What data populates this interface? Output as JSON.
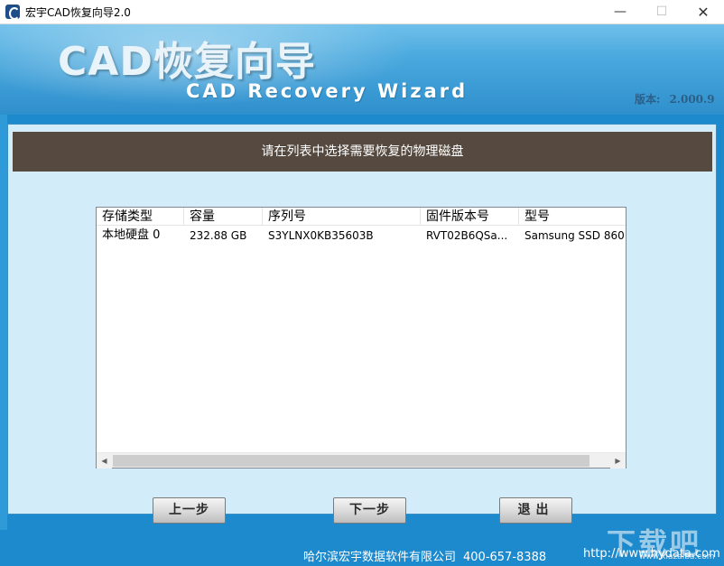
{
  "window": {
    "title": "宏宇CAD恢复向导2.0",
    "minimize_glyph": "—",
    "maximize_glyph": "☐",
    "close_glyph": "✕"
  },
  "banner": {
    "title_cn": "CAD恢复向导",
    "title_en": "CAD Recovery Wizard",
    "version_label": "版本:",
    "version_value": "2.000.9"
  },
  "instruction": "请在列表中选择需要恢复的物理磁盘",
  "disk_list": {
    "columns": [
      "存储类型",
      "容量",
      "序列号",
      "固件版本号",
      "型号"
    ],
    "rows": [
      {
        "type": "本地硬盘 0",
        "capacity": "232.88 GB",
        "serial": "S3YLNX0KB35603B",
        "firmware": "RVT02B6QSa...",
        "model": "Samsung SSD 860"
      }
    ],
    "scroll_left_glyph": "◀",
    "scroll_right_glyph": "▶"
  },
  "buttons": {
    "prev": "上一步",
    "next": "下一步",
    "exit": "退出"
  },
  "footer": {
    "company": "哈尔滨宏宇数据软件有限公司",
    "phone": "400-657-8388",
    "url": "http://www.hydata.com"
  },
  "watermark": {
    "text": "下载吧",
    "url": "www.xiazaiba.com"
  },
  "colors": {
    "banner": "#4aa9de",
    "frame": "#1d8acd",
    "panel": "#d2ecfa",
    "instruction_bar": "#564a40"
  }
}
